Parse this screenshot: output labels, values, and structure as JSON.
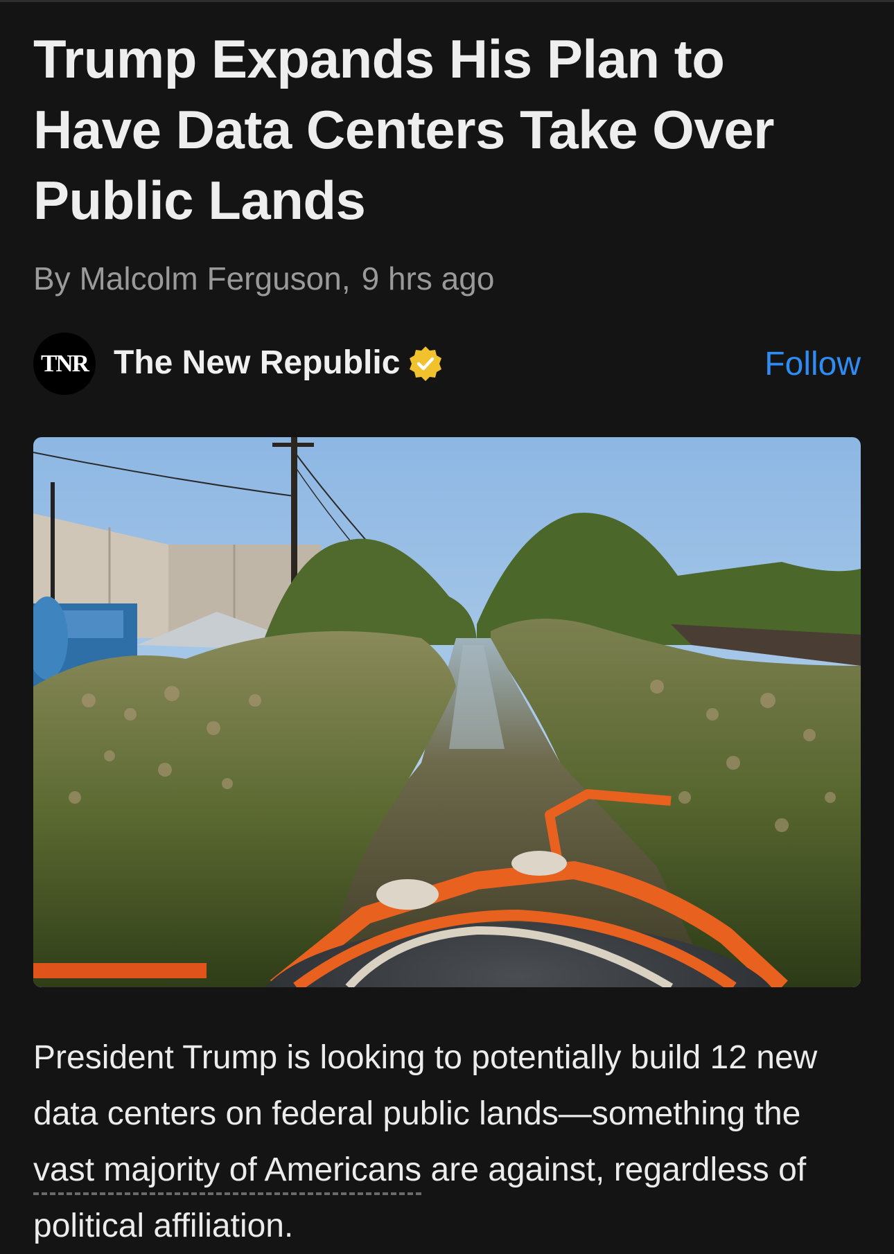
{
  "article": {
    "headline": "Trump Expands His Plan to Have Data Centers Take Over Public Lands",
    "byline_author": "By Malcolm Ferguson,",
    "byline_time": "9 hrs ago",
    "publisher": {
      "logo_text": "TNR",
      "name": "The New Republic",
      "verified_icon": "verified-badge-icon",
      "follow_label": "Follow"
    },
    "image": {
      "icon": "photo-canal-with-oil-boom"
    },
    "body": {
      "before_link": "President Trump is looking to potentially build 12 new data centers on federal public lands—something the ",
      "link_text": "vast majority of Americans",
      "after_link": " are against, regardless of political affiliation."
    }
  },
  "colors": {
    "background": "#141414",
    "headline": "#eeeeee",
    "byline": "#9a9a9a",
    "follow": "#2f8cf3",
    "verified_badge": "#f2c12e"
  }
}
